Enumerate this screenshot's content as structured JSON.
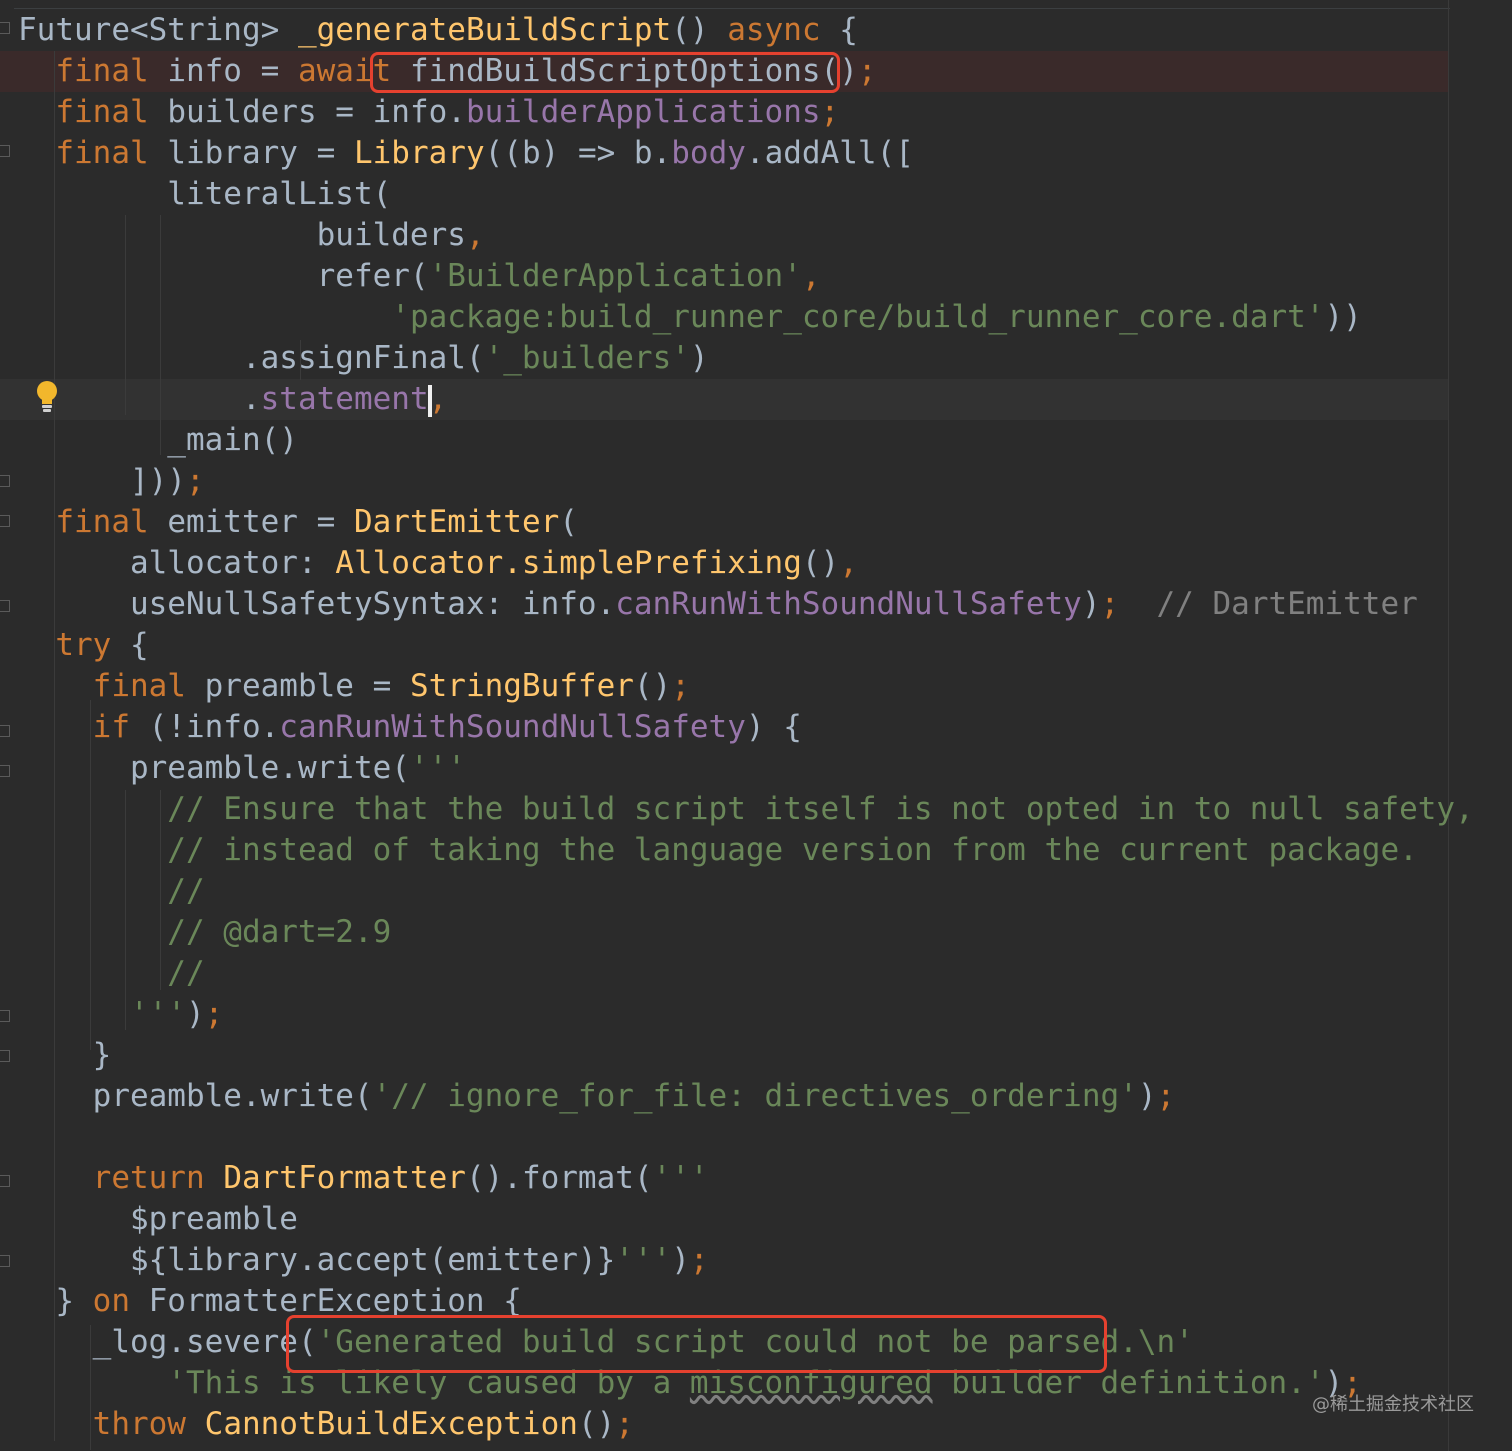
{
  "editor": {
    "language": "Dart",
    "colors": {
      "background": "#2b2b2b",
      "keyword": "#cc7832",
      "function": "#ffc66d",
      "property": "#9876aa",
      "string": "#6a8759",
      "comment": "#808080",
      "text": "#a9b7c6",
      "highlight_box": "#e5412f"
    },
    "lines": [
      [
        [
          "plain",
          "Future<String> "
        ],
        [
          "fn",
          "_generateBuildScript"
        ],
        [
          "plain",
          "() "
        ],
        [
          "kw",
          "async"
        ],
        [
          "plain",
          " {"
        ]
      ],
      [
        [
          "plain",
          "  "
        ],
        [
          "kw",
          "final"
        ],
        [
          "plain",
          " info = "
        ],
        [
          "kw",
          "await"
        ],
        [
          "plain",
          " findBuildScriptOptions()"
        ],
        [
          "kw",
          ";"
        ]
      ],
      [
        [
          "plain",
          "  "
        ],
        [
          "kw",
          "final"
        ],
        [
          "plain",
          " builders = info."
        ],
        [
          "prop",
          "builderApplications"
        ],
        [
          "kw",
          ";"
        ]
      ],
      [
        [
          "plain",
          "  "
        ],
        [
          "kw",
          "final"
        ],
        [
          "plain",
          " library = "
        ],
        [
          "fn",
          "Library"
        ],
        [
          "plain",
          "((b) => b."
        ],
        [
          "prop",
          "body"
        ],
        [
          "plain",
          ".addAll(["
        ]
      ],
      [
        [
          "plain",
          "        literalList("
        ]
      ],
      [
        [
          "plain",
          "                builders"
        ],
        [
          "kw",
          ","
        ]
      ],
      [
        [
          "plain",
          "                refer("
        ],
        [
          "str",
          "'BuilderApplication'"
        ],
        [
          "kw",
          ","
        ]
      ],
      [
        [
          "plain",
          "                    "
        ],
        [
          "str",
          "'package:build_runner_core/build_runner_core.dart'"
        ],
        [
          "plain",
          "))"
        ]
      ],
      [
        [
          "plain",
          "            .assignFinal("
        ],
        [
          "str",
          "'_builders'"
        ],
        [
          "plain",
          ")"
        ]
      ],
      [
        [
          "plain",
          "            ."
        ],
        [
          "prop",
          "statement"
        ],
        [
          "kw",
          ","
        ]
      ],
      [
        [
          "plain",
          "        _main()"
        ]
      ],
      [
        [
          "plain",
          "      ]))"
        ],
        [
          "kw",
          ";"
        ]
      ],
      [
        [
          "plain",
          "  "
        ],
        [
          "kw",
          "final"
        ],
        [
          "plain",
          " emitter = "
        ],
        [
          "fn",
          "DartEmitter"
        ],
        [
          "plain",
          "("
        ]
      ],
      [
        [
          "plain",
          "      allocator: "
        ],
        [
          "fn",
          "Allocator.simplePrefixing"
        ],
        [
          "plain",
          "()"
        ],
        [
          "kw",
          ","
        ]
      ],
      [
        [
          "plain",
          "      useNullSafetySyntax: info."
        ],
        [
          "prop",
          "canRunWithSoundNullSafety"
        ],
        [
          "plain",
          ")"
        ],
        [
          "kw",
          ";"
        ],
        [
          "cm",
          "  // DartEmitter"
        ]
      ],
      [
        [
          "plain",
          "  "
        ],
        [
          "kw",
          "try"
        ],
        [
          "plain",
          " {"
        ]
      ],
      [
        [
          "plain",
          "    "
        ],
        [
          "kw",
          "final"
        ],
        [
          "plain",
          " preamble = "
        ],
        [
          "fn",
          "StringBuffer"
        ],
        [
          "plain",
          "()"
        ],
        [
          "kw",
          ";"
        ]
      ],
      [
        [
          "plain",
          "    "
        ],
        [
          "kw",
          "if"
        ],
        [
          "plain",
          " (!info."
        ],
        [
          "prop",
          "canRunWithSoundNullSafety"
        ],
        [
          "plain",
          ") {"
        ]
      ],
      [
        [
          "plain",
          "      preamble.write("
        ],
        [
          "str",
          "'''"
        ]
      ],
      [
        [
          "str",
          "        // Ensure that the build script itself is not opted in to null safety,"
        ]
      ],
      [
        [
          "str",
          "        // instead of taking the language version from the current package."
        ]
      ],
      [
        [
          "str",
          "        //"
        ]
      ],
      [
        [
          "str",
          "        // @dart=2.9"
        ]
      ],
      [
        [
          "str",
          "        //"
        ]
      ],
      [
        [
          "str",
          "      '''"
        ],
        [
          "plain",
          ")"
        ],
        [
          "kw",
          ";"
        ]
      ],
      [
        [
          "plain",
          "    }"
        ]
      ],
      [
        [
          "plain",
          "    preamble.write("
        ],
        [
          "str",
          "'// ignore_for_file: directives_ordering'"
        ],
        [
          "plain",
          ")"
        ],
        [
          "kw",
          ";"
        ]
      ],
      [
        [
          "plain",
          ""
        ]
      ],
      [
        [
          "plain",
          "    "
        ],
        [
          "kw",
          "return"
        ],
        [
          "plain",
          " "
        ],
        [
          "fn",
          "DartFormatter"
        ],
        [
          "plain",
          "().format("
        ],
        [
          "str",
          "'''"
        ]
      ],
      [
        [
          "str",
          "      "
        ],
        [
          "plain",
          "$preamble"
        ]
      ],
      [
        [
          "str",
          "      "
        ],
        [
          "plain",
          "${library.accept(emitter)}"
        ],
        [
          "str",
          "'''"
        ],
        [
          "plain",
          ")"
        ],
        [
          "kw",
          ";"
        ]
      ],
      [
        [
          "plain",
          "  } "
        ],
        [
          "kw",
          "on"
        ],
        [
          "plain",
          " FormatterException {"
        ]
      ],
      [
        [
          "plain",
          "    _log.severe("
        ],
        [
          "str",
          "'Generated build script could not be parsed.\\n'"
        ]
      ],
      [
        [
          "plain",
          "        "
        ],
        [
          "str",
          "'This is likely caused by a "
        ],
        [
          "strw",
          "misconfigured"
        ],
        [
          "str",
          " builder definition.'"
        ],
        [
          "plain",
          ")"
        ],
        [
          "kw",
          ";"
        ]
      ],
      [
        [
          "plain",
          "    "
        ],
        [
          "kw",
          "throw"
        ],
        [
          "plain",
          " "
        ],
        [
          "fn",
          "CannotBuildException"
        ],
        [
          "plain",
          "()"
        ],
        [
          "kw",
          ";"
        ]
      ]
    ]
  },
  "watermark": "@稀土掘金技术社区"
}
